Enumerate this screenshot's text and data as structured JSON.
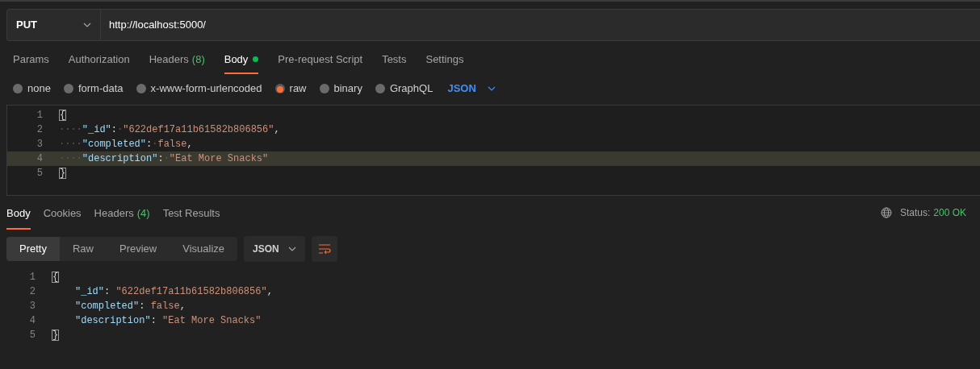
{
  "request": {
    "method": "PUT",
    "url": "http://localhost:5000/"
  },
  "request_tabs": [
    {
      "label": "Params",
      "selected": false
    },
    {
      "label": "Authorization",
      "selected": false
    },
    {
      "label": "Headers",
      "count": "(8)",
      "selected": false
    },
    {
      "label": "Body",
      "indicator": true,
      "selected": true
    },
    {
      "label": "Pre-request Script",
      "selected": false
    },
    {
      "label": "Tests",
      "selected": false
    },
    {
      "label": "Settings",
      "selected": false
    }
  ],
  "body_types": [
    {
      "label": "none",
      "selected": false
    },
    {
      "label": "form-data",
      "selected": false
    },
    {
      "label": "x-www-form-urlencoded",
      "selected": false
    },
    {
      "label": "raw",
      "selected": true
    },
    {
      "label": "binary",
      "selected": false
    },
    {
      "label": "GraphQL",
      "selected": false
    }
  ],
  "body_language": "JSON",
  "request_editor": {
    "lines": [
      {
        "number": "1",
        "highlighted": false,
        "tokens": [
          {
            "kind": "bracket",
            "text": "{"
          }
        ]
      },
      {
        "number": "2",
        "highlighted": false,
        "tokens": [
          {
            "kind": "whitespace",
            "text": "····"
          },
          {
            "kind": "key",
            "text": "\"_id\""
          },
          {
            "kind": "punct",
            "text": ":"
          },
          {
            "kind": "whitespace",
            "text": "·"
          },
          {
            "kind": "string",
            "text": "\"622def17a11b61582b806856\""
          },
          {
            "kind": "punct",
            "text": ","
          }
        ]
      },
      {
        "number": "3",
        "highlighted": false,
        "tokens": [
          {
            "kind": "whitespace",
            "text": "····"
          },
          {
            "kind": "key",
            "text": "\"completed\""
          },
          {
            "kind": "punct",
            "text": ":"
          },
          {
            "kind": "whitespace",
            "text": "·"
          },
          {
            "kind": "literal",
            "text": "false"
          },
          {
            "kind": "punct",
            "text": ","
          }
        ]
      },
      {
        "number": "4",
        "highlighted": true,
        "tokens": [
          {
            "kind": "whitespace",
            "text": "····"
          },
          {
            "kind": "key",
            "text": "\"description\""
          },
          {
            "kind": "punct",
            "text": ":"
          },
          {
            "kind": "whitespace",
            "text": "·"
          },
          {
            "kind": "string",
            "text": "\"Eat More Snacks\""
          }
        ]
      },
      {
        "number": "5",
        "highlighted": false,
        "tokens": [
          {
            "kind": "bracket",
            "text": "}"
          }
        ]
      }
    ]
  },
  "response_tabs": [
    {
      "label": "Body",
      "selected": true
    },
    {
      "label": "Cookies",
      "selected": false
    },
    {
      "label": "Headers",
      "count": "(4)",
      "selected": false
    },
    {
      "label": "Test Results",
      "selected": false
    }
  ],
  "status": {
    "label": "Status:",
    "value": "200 OK"
  },
  "view_modes": [
    {
      "label": "Pretty",
      "selected": true
    },
    {
      "label": "Raw",
      "selected": false
    },
    {
      "label": "Preview",
      "selected": false
    },
    {
      "label": "Visualize",
      "selected": false
    }
  ],
  "response_format": "JSON",
  "response_body": {
    "lines": [
      {
        "number": "1",
        "tokens": [
          {
            "kind": "bracket",
            "text": "{"
          }
        ]
      },
      {
        "number": "2",
        "indented": true,
        "tokens": [
          {
            "kind": "key",
            "text": "\"_id\""
          },
          {
            "kind": "punct",
            "text": ": "
          },
          {
            "kind": "string",
            "text": "\"622def17a11b61582b806856\""
          },
          {
            "kind": "punct",
            "text": ","
          }
        ]
      },
      {
        "number": "3",
        "indented": true,
        "tokens": [
          {
            "kind": "key",
            "text": "\"completed\""
          },
          {
            "kind": "punct",
            "text": ": "
          },
          {
            "kind": "literal",
            "text": "false"
          },
          {
            "kind": "punct",
            "text": ","
          }
        ]
      },
      {
        "number": "4",
        "indented": true,
        "tokens": [
          {
            "kind": "key",
            "text": "\"description\""
          },
          {
            "kind": "punct",
            "text": ": "
          },
          {
            "kind": "string",
            "text": "\"Eat More Snacks\""
          }
        ]
      },
      {
        "number": "5",
        "tokens": [
          {
            "kind": "bracket",
            "text": "}"
          }
        ]
      }
    ]
  }
}
